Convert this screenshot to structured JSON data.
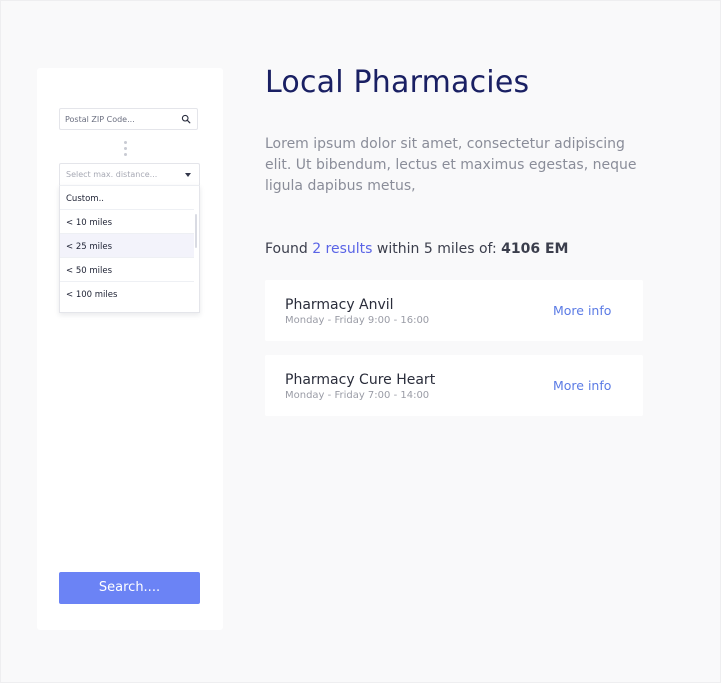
{
  "sidebar": {
    "zip_placeholder": "Postal ZIP Code...",
    "distance_placeholder": "Select max. distance...",
    "distance_options": [
      "Custom..",
      "< 10 miles",
      "< 25 miles",
      "< 50 miles",
      "< 100 miles"
    ],
    "selected_option": "< 25 miles",
    "search_label": "Search...."
  },
  "main": {
    "title": "Local Pharmacies",
    "description": "Lorem ipsum dolor sit amet, consectetur adipiscing elit. Ut bibendum, lectus et maximus egestas, neque ligula dapibus metus,",
    "found": {
      "prefix": "Found ",
      "count": "2 results",
      "middle": " within 5 miles of: ",
      "zip": "4106 EM"
    },
    "results": [
      {
        "name": "Pharmacy Anvil",
        "hours": "Monday - Friday 9:00 - 16:00",
        "link": "More info"
      },
      {
        "name": "Pharmacy Cure Heart",
        "hours": "Monday - Friday 7:00 - 14:00",
        "link": "More info"
      }
    ]
  },
  "colors": {
    "accent": "#6b83f5",
    "title": "#1a2063",
    "link": "#5b7be5",
    "highlight": "#5a64e6"
  }
}
